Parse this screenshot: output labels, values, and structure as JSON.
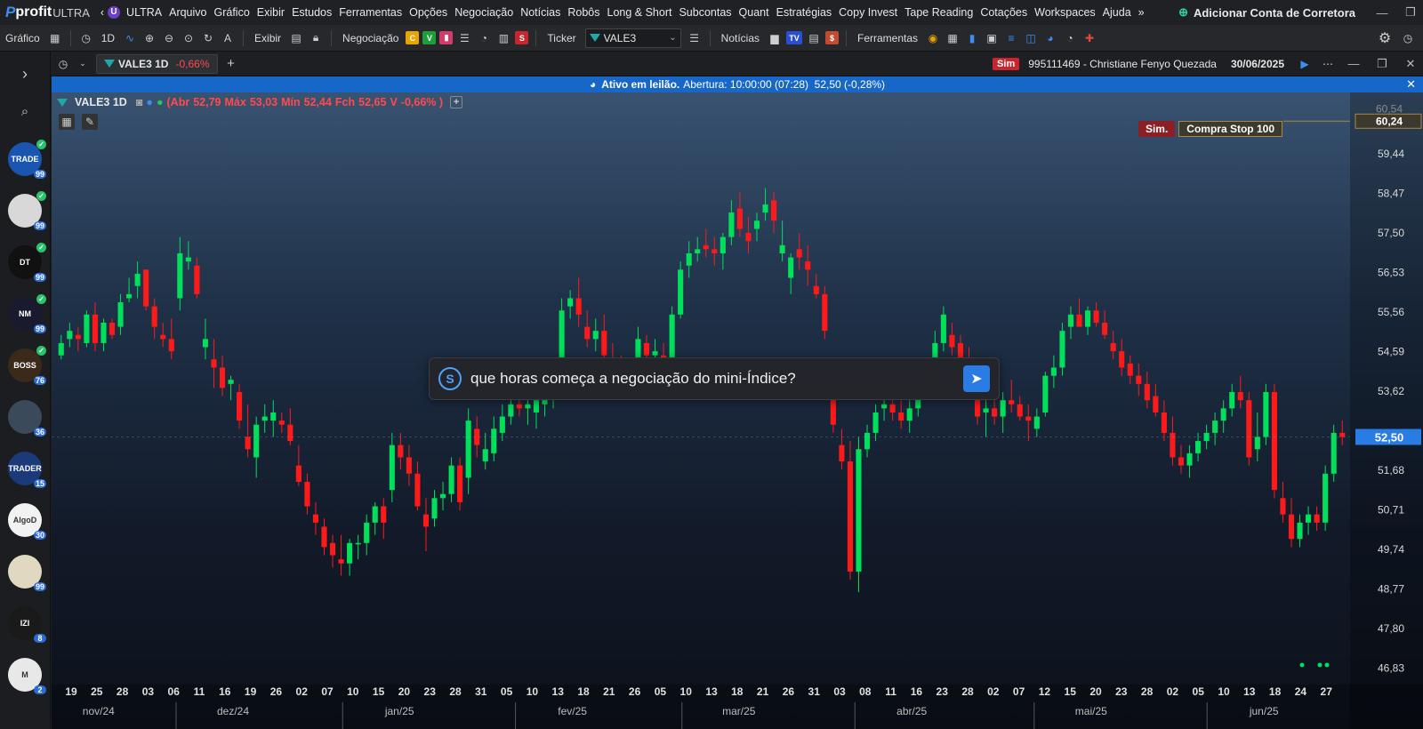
{
  "menu": {
    "logo_text": "profit",
    "logo_suffix": "ULTRA",
    "ultra_badge": "U",
    "ultra": "ULTRA",
    "items": [
      "Arquivo",
      "Gráfico",
      "Exibir",
      "Estudos",
      "Ferramentas",
      "Opções",
      "Negociação",
      "Notícias",
      "Robôs",
      "Long & Short",
      "Subcontas",
      "Quant",
      "Estratégias",
      "Copy Invest",
      "Tape Reading",
      "Cotações",
      "Workspaces",
      "Ajuda"
    ],
    "add_broker": "Adicionar Conta de Corretora"
  },
  "toolbar": {
    "grafico": "Gráfico",
    "period": "1D",
    "exibir": "Exibir",
    "negociacao": "Negociação",
    "ticker_label": "Ticker",
    "ticker_value": "VALE3",
    "noticias": "Notícias",
    "ferramentas": "Ferramentas",
    "neg_squares": [
      "C",
      "V"
    ]
  },
  "tab": {
    "label": "VALE3 1D",
    "change": "-0,66%",
    "sim_badge": "Sim",
    "account": "995111469 - Christiane Fenyo Quezada",
    "date": "30/06/2025"
  },
  "auction": {
    "title": "Ativo em leilão.",
    "details": "Abertura: 10:00:00 (07:28)  52,50 (-0,28%)"
  },
  "ohlc": {
    "symbol": "VALE3 1D",
    "abr_label": "(Abr",
    "abr": "52,79",
    "max_label": "Máx",
    "max": "53,03",
    "min_label": "Mín",
    "min": "52,44",
    "fch_label": "Fch",
    "fch": "52,65",
    "v_label": "V",
    "v": "-0,66% )"
  },
  "order": {
    "sim": "Sim.",
    "label": "Compra Stop 100",
    "price": "60,24",
    "faint_price": "60,54"
  },
  "price_axis": [
    "59,44",
    "58,47",
    "57,50",
    "56,53",
    "55,56",
    "54,59",
    "53,62",
    "51,68",
    "50,71",
    "49,74",
    "48,77",
    "47,80",
    "46,83"
  ],
  "current_price": "52,50",
  "prompt": {
    "text": "que horas começa a negociação do mini-Índice?"
  },
  "sidebar_bots": [
    {
      "label": "TRADE",
      "count": "99",
      "color": "#1a56b0"
    },
    {
      "label": "",
      "count": "99",
      "color": "#d8d8d8"
    },
    {
      "label": "DT",
      "count": "99",
      "color": "#111111"
    },
    {
      "label": "NM",
      "count": "99",
      "color": "#1a1a2e"
    },
    {
      "label": "BOSS",
      "count": "76",
      "color": "#3b2a1a"
    },
    {
      "label": "",
      "count": "36",
      "color": "#3a4a5a"
    },
    {
      "label": "TRADER",
      "count": "15",
      "color": "#1a3a7a"
    },
    {
      "label": "AlgoD",
      "count": "30",
      "color": "#f2f2f2"
    },
    {
      "label": "",
      "count": "99",
      "color": "#e0d8c0"
    },
    {
      "label": "IZI",
      "count": "8",
      "color": "#1a1a1a"
    },
    {
      "label": "M",
      "count": "2",
      "color": "#e8e8e8"
    }
  ],
  "x_days": [
    "19",
    "25",
    "28",
    "03",
    "06",
    "11",
    "16",
    "19",
    "26",
    "02",
    "07",
    "10",
    "15",
    "20",
    "23",
    "28",
    "31",
    "05",
    "10",
    "13",
    "18",
    "21",
    "26",
    "05",
    "10",
    "13",
    "18",
    "21",
    "26",
    "31",
    "03",
    "08",
    "11",
    "16",
    "23",
    "28",
    "02",
    "07",
    "12",
    "15",
    "20",
    "23",
    "28",
    "02",
    "05",
    "10",
    "13",
    "18",
    "24",
    "27"
  ],
  "x_months": [
    "nov/24",
    "dez/24",
    "jan/25",
    "fev/25",
    "mar/25",
    "abr/25",
    "mai/25",
    "jun/25"
  ],
  "colors": {
    "up": "#00e05a",
    "down": "#ff1a1a",
    "accent": "#1767c9"
  },
  "chart_data": {
    "type": "candlestick",
    "title": "VALE3 1D",
    "ylim": [
      46.3,
      60.9
    ],
    "candles": [
      [
        54.5,
        55.0,
        54.4,
        54.8
      ],
      [
        54.9,
        55.3,
        54.7,
        55.1
      ],
      [
        55.0,
        55.2,
        54.6,
        54.9
      ],
      [
        54.8,
        55.6,
        54.7,
        55.5
      ],
      [
        55.5,
        55.8,
        54.6,
        54.8
      ],
      [
        54.8,
        55.4,
        54.6,
        55.3
      ],
      [
        55.3,
        55.4,
        54.9,
        55.0
      ],
      [
        55.2,
        56.0,
        55.0,
        55.8
      ],
      [
        55.9,
        56.4,
        55.8,
        56.0
      ],
      [
        56.2,
        56.8,
        55.9,
        56.5
      ],
      [
        56.6,
        56.6,
        55.6,
        55.7
      ],
      [
        55.7,
        55.9,
        54.9,
        55.2
      ],
      [
        55.0,
        55.3,
        54.7,
        54.9
      ],
      [
        54.9,
        55.4,
        54.4,
        54.6
      ],
      [
        55.9,
        57.4,
        55.6,
        57.0
      ],
      [
        56.8,
        57.3,
        56.6,
        56.9
      ],
      [
        56.7,
        56.9,
        55.9,
        56.0
      ],
      [
        54.7,
        55.4,
        54.4,
        54.9
      ],
      [
        54.4,
        54.9,
        53.7,
        54.2
      ],
      [
        54.2,
        54.5,
        53.5,
        53.7
      ],
      [
        53.8,
        54.0,
        53.4,
        53.9
      ],
      [
        53.6,
        53.8,
        52.7,
        52.9
      ],
      [
        52.5,
        53.3,
        52.0,
        52.2
      ],
      [
        52.0,
        53.0,
        51.5,
        52.8
      ],
      [
        52.9,
        53.3,
        52.6,
        53.0
      ],
      [
        52.9,
        53.4,
        52.5,
        53.1
      ],
      [
        52.9,
        53.1,
        52.6,
        52.8
      ],
      [
        52.8,
        53.2,
        52.3,
        52.4
      ],
      [
        51.8,
        52.3,
        51.3,
        51.4
      ],
      [
        51.4,
        51.6,
        50.6,
        50.8
      ],
      [
        50.6,
        50.9,
        50.1,
        50.4
      ],
      [
        50.3,
        50.5,
        49.6,
        49.8
      ],
      [
        49.9,
        50.1,
        49.3,
        49.6
      ],
      [
        49.5,
        50.1,
        49.1,
        49.4
      ],
      [
        49.4,
        50.0,
        49.1,
        49.9
      ],
      [
        49.9,
        50.1,
        49.5,
        49.9
      ],
      [
        49.9,
        50.6,
        49.6,
        50.4
      ],
      [
        50.4,
        50.9,
        50.1,
        50.8
      ],
      [
        50.8,
        51.0,
        50.0,
        50.4
      ],
      [
        51.2,
        52.6,
        50.9,
        52.3
      ],
      [
        52.3,
        52.6,
        51.7,
        52.0
      ],
      [
        52.0,
        52.3,
        51.3,
        51.6
      ],
      [
        51.6,
        51.9,
        50.7,
        50.8
      ],
      [
        50.6,
        51.0,
        49.7,
        50.3
      ],
      [
        50.5,
        51.2,
        50.3,
        51.0
      ],
      [
        51.0,
        51.4,
        50.7,
        51.1
      ],
      [
        51.1,
        52.0,
        50.9,
        51.8
      ],
      [
        51.8,
        52.0,
        50.7,
        50.9
      ],
      [
        51.5,
        53.2,
        51.1,
        52.9
      ],
      [
        52.7,
        53.0,
        52.0,
        52.3
      ],
      [
        51.9,
        52.6,
        51.7,
        52.2
      ],
      [
        52.1,
        53.0,
        51.9,
        52.7
      ],
      [
        52.6,
        53.3,
        52.4,
        53.0
      ],
      [
        53.0,
        53.4,
        52.8,
        53.3
      ],
      [
        53.3,
        53.6,
        53.0,
        53.2
      ],
      [
        53.2,
        53.5,
        52.8,
        53.3
      ],
      [
        53.1,
        53.5,
        52.7,
        53.4
      ],
      [
        53.3,
        53.6,
        53.0,
        53.5
      ],
      [
        53.5,
        53.9,
        53.2,
        53.7
      ],
      [
        53.8,
        55.9,
        53.6,
        55.6
      ],
      [
        55.7,
        56.1,
        55.4,
        55.9
      ],
      [
        55.9,
        56.4,
        55.2,
        55.5
      ],
      [
        55.2,
        55.6,
        54.7,
        54.9
      ],
      [
        54.9,
        55.4,
        54.6,
        55.1
      ],
      [
        55.1,
        55.5,
        54.3,
        54.5
      ],
      [
        54.1,
        54.8,
        53.7,
        54.0
      ],
      [
        54.0,
        54.5,
        53.4,
        53.6
      ],
      [
        53.6,
        54.3,
        53.5,
        54.2
      ],
      [
        54.2,
        55.2,
        54.0,
        54.9
      ],
      [
        54.8,
        55.0,
        54.3,
        54.5
      ],
      [
        54.5,
        54.9,
        54.2,
        54.6
      ],
      [
        54.5,
        54.8,
        53.9,
        54.2
      ],
      [
        54.2,
        55.7,
        54.0,
        55.5
      ],
      [
        55.5,
        56.8,
        55.4,
        56.6
      ],
      [
        56.7,
        57.3,
        56.4,
        57.0
      ],
      [
        57.0,
        57.4,
        56.8,
        57.1
      ],
      [
        57.2,
        57.6,
        56.9,
        57.1
      ],
      [
        57.1,
        57.4,
        56.7,
        57.0
      ],
      [
        57.0,
        57.5,
        56.6,
        57.4
      ],
      [
        57.4,
        58.3,
        57.2,
        58.0
      ],
      [
        58.1,
        58.5,
        57.4,
        57.6
      ],
      [
        57.5,
        57.9,
        57.0,
        57.3
      ],
      [
        57.6,
        58.0,
        57.3,
        57.8
      ],
      [
        58.0,
        58.6,
        57.8,
        58.2
      ],
      [
        58.3,
        58.5,
        57.5,
        57.8
      ],
      [
        57.0,
        57.8,
        56.8,
        57.2
      ],
      [
        56.4,
        57.0,
        56.0,
        56.9
      ],
      [
        57.1,
        57.5,
        56.6,
        56.9
      ],
      [
        56.8,
        57.2,
        56.2,
        56.6
      ],
      [
        56.2,
        56.5,
        55.9,
        56.0
      ],
      [
        56.0,
        56.2,
        54.9,
        55.1
      ],
      [
        53.5,
        53.7,
        52.6,
        52.8
      ],
      [
        52.3,
        52.7,
        51.7,
        51.9
      ],
      [
        51.9,
        52.4,
        49.0,
        49.2
      ],
      [
        49.2,
        52.5,
        48.7,
        52.2
      ],
      [
        52.2,
        52.8,
        52.0,
        52.6
      ],
      [
        52.6,
        53.3,
        52.4,
        53.1
      ],
      [
        53.2,
        53.6,
        52.9,
        53.3
      ],
      [
        53.3,
        53.8,
        52.9,
        53.1
      ],
      [
        53.1,
        53.4,
        52.7,
        52.9
      ],
      [
        52.9,
        53.4,
        52.6,
        53.2
      ],
      [
        53.2,
        53.8,
        53.0,
        53.7
      ],
      [
        53.8,
        54.4,
        53.6,
        54.3
      ],
      [
        54.3,
        55.1,
        54.1,
        54.8
      ],
      [
        54.8,
        55.7,
        54.6,
        55.5
      ],
      [
        55.0,
        55.3,
        54.5,
        54.7
      ],
      [
        54.8,
        55.0,
        54.2,
        54.4
      ],
      [
        54.4,
        54.7,
        53.8,
        53.9
      ],
      [
        53.6,
        53.9,
        52.8,
        53.0
      ],
      [
        53.1,
        53.5,
        52.5,
        53.2
      ],
      [
        53.2,
        53.4,
        52.8,
        53.0
      ],
      [
        53.0,
        53.6,
        52.6,
        53.4
      ],
      [
        53.4,
        53.9,
        53.1,
        53.3
      ],
      [
        53.3,
        53.5,
        52.9,
        53.0
      ],
      [
        53.0,
        53.3,
        52.4,
        52.9
      ],
      [
        52.7,
        53.2,
        52.5,
        53.0
      ],
      [
        53.1,
        54.1,
        53.0,
        54.0
      ],
      [
        54.0,
        54.5,
        53.7,
        54.2
      ],
      [
        54.2,
        55.3,
        54.0,
        55.1
      ],
      [
        55.2,
        55.7,
        54.9,
        55.5
      ],
      [
        55.5,
        55.9,
        55.2,
        55.2
      ],
      [
        55.2,
        55.7,
        55.0,
        55.6
      ],
      [
        55.6,
        55.8,
        55.2,
        55.3
      ],
      [
        55.3,
        55.6,
        54.9,
        55.0
      ],
      [
        54.8,
        55.1,
        54.4,
        54.6
      ],
      [
        54.6,
        54.9,
        54.0,
        54.2
      ],
      [
        54.3,
        54.5,
        53.8,
        54.0
      ],
      [
        54.0,
        54.3,
        53.5,
        53.8
      ],
      [
        53.8,
        54.1,
        53.2,
        53.4
      ],
      [
        53.5,
        53.8,
        53.0,
        53.1
      ],
      [
        53.1,
        53.4,
        52.4,
        52.6
      ],
      [
        52.6,
        53.0,
        51.8,
        52.0
      ],
      [
        52.0,
        52.3,
        51.6,
        51.8
      ],
      [
        51.8,
        52.3,
        51.5,
        52.1
      ],
      [
        52.1,
        52.6,
        51.9,
        52.4
      ],
      [
        52.4,
        52.8,
        52.2,
        52.6
      ],
      [
        52.6,
        53.1,
        52.3,
        52.9
      ],
      [
        52.9,
        53.4,
        52.6,
        53.2
      ],
      [
        53.2,
        53.8,
        53.0,
        53.6
      ],
      [
        53.6,
        54.0,
        53.2,
        53.4
      ],
      [
        53.4,
        53.6,
        51.8,
        52.0
      ],
      [
        52.2,
        53.1,
        51.9,
        52.5
      ],
      [
        52.5,
        53.8,
        52.3,
        53.6
      ],
      [
        53.6,
        53.8,
        51.0,
        51.2
      ],
      [
        51.0,
        51.4,
        50.4,
        50.6
      ],
      [
        50.6,
        51.0,
        49.8,
        50.0
      ],
      [
        50.0,
        50.6,
        49.8,
        50.4
      ],
      [
        50.4,
        50.8,
        50.1,
        50.6
      ],
      [
        50.6,
        50.8,
        50.2,
        50.4
      ],
      [
        50.4,
        51.8,
        50.2,
        51.6
      ],
      [
        51.6,
        52.8,
        51.4,
        52.6
      ],
      [
        52.6,
        52.9,
        52.3,
        52.5
      ]
    ]
  }
}
